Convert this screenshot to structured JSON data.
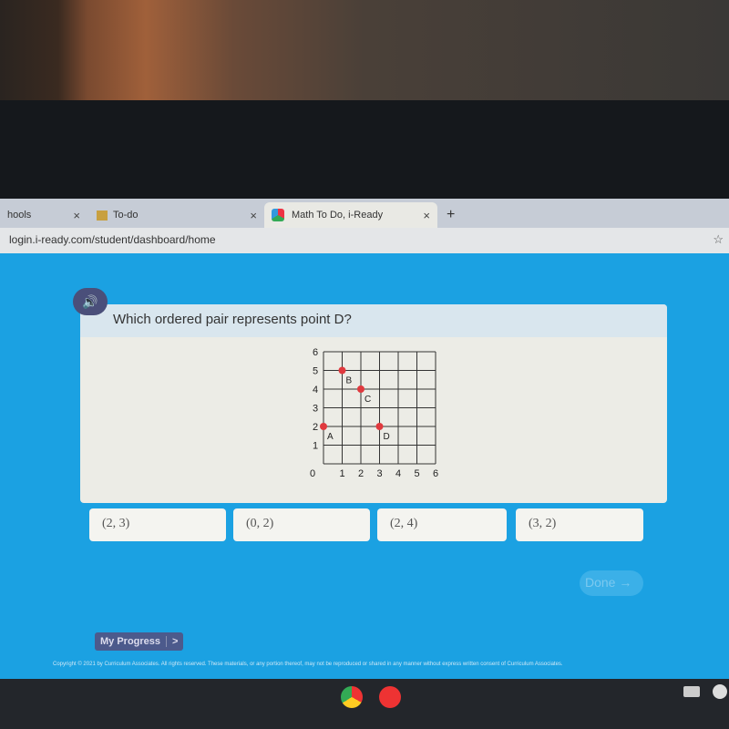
{
  "browser": {
    "tabs": [
      {
        "label": "hools"
      },
      {
        "label": "To-do"
      },
      {
        "label": "Math To Do, i-Ready",
        "active": true
      }
    ],
    "new_tab": "+",
    "close": "×",
    "url": "login.i-ready.com/student/dashboard/home",
    "star": "☆"
  },
  "question": {
    "text": "Which ordered pair represents point D?",
    "speaker_icon": "speaker-icon"
  },
  "chart_data": {
    "type": "scatter",
    "xlim": [
      0,
      6
    ],
    "ylim": [
      0,
      6
    ],
    "grid": true,
    "x_ticks": [
      "0",
      "1",
      "2",
      "3",
      "4",
      "5",
      "6"
    ],
    "y_ticks": [
      "1",
      "2",
      "3",
      "4",
      "5",
      "6"
    ],
    "points": [
      {
        "label": "A",
        "x": 0,
        "y": 2
      },
      {
        "label": "B",
        "x": 1,
        "y": 5
      },
      {
        "label": "C",
        "x": 2,
        "y": 4
      },
      {
        "label": "D",
        "x": 3,
        "y": 2
      }
    ],
    "point_color": "#e0393e"
  },
  "answers": [
    "(2, 3)",
    "(0, 2)",
    "(2, 4)",
    "(3, 2)"
  ],
  "done_label": "Done →",
  "my_progress": {
    "label": "My Progress",
    "arrow": ">"
  },
  "copyright": "Copyright © 2021 by Curriculum Associates. All rights reserved. These materials, or any portion thereof, may not be reproduced or shared in any manner without express written consent of Curriculum Associates."
}
